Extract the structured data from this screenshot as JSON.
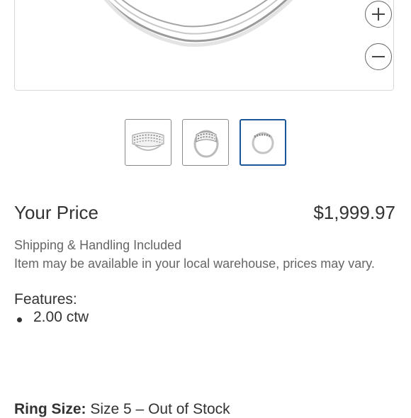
{
  "viewer": {
    "zoom_in_icon": "plus-icon",
    "zoom_out_icon": "minus-icon"
  },
  "thumbnails": [
    {
      "icon": "ring-front-view",
      "selected": false
    },
    {
      "icon": "ring-angle-view",
      "selected": false
    },
    {
      "icon": "ring-top-view",
      "selected": true
    }
  ],
  "price": {
    "label": "Your Price",
    "value": "$1,999.97"
  },
  "shipping": {
    "line1": "Shipping & Handling Included",
    "line2": "Item may be available in your local warehouse, prices may vary."
  },
  "features": {
    "title": "Features:",
    "items": [
      "2.00 ctw"
    ]
  },
  "ring_size": {
    "label": "Ring Size:",
    "value": "Size 5 – Out of Stock"
  },
  "colors": {
    "selected_border": "#1a5799",
    "text_primary": "#333333",
    "text_secondary": "#666666"
  }
}
